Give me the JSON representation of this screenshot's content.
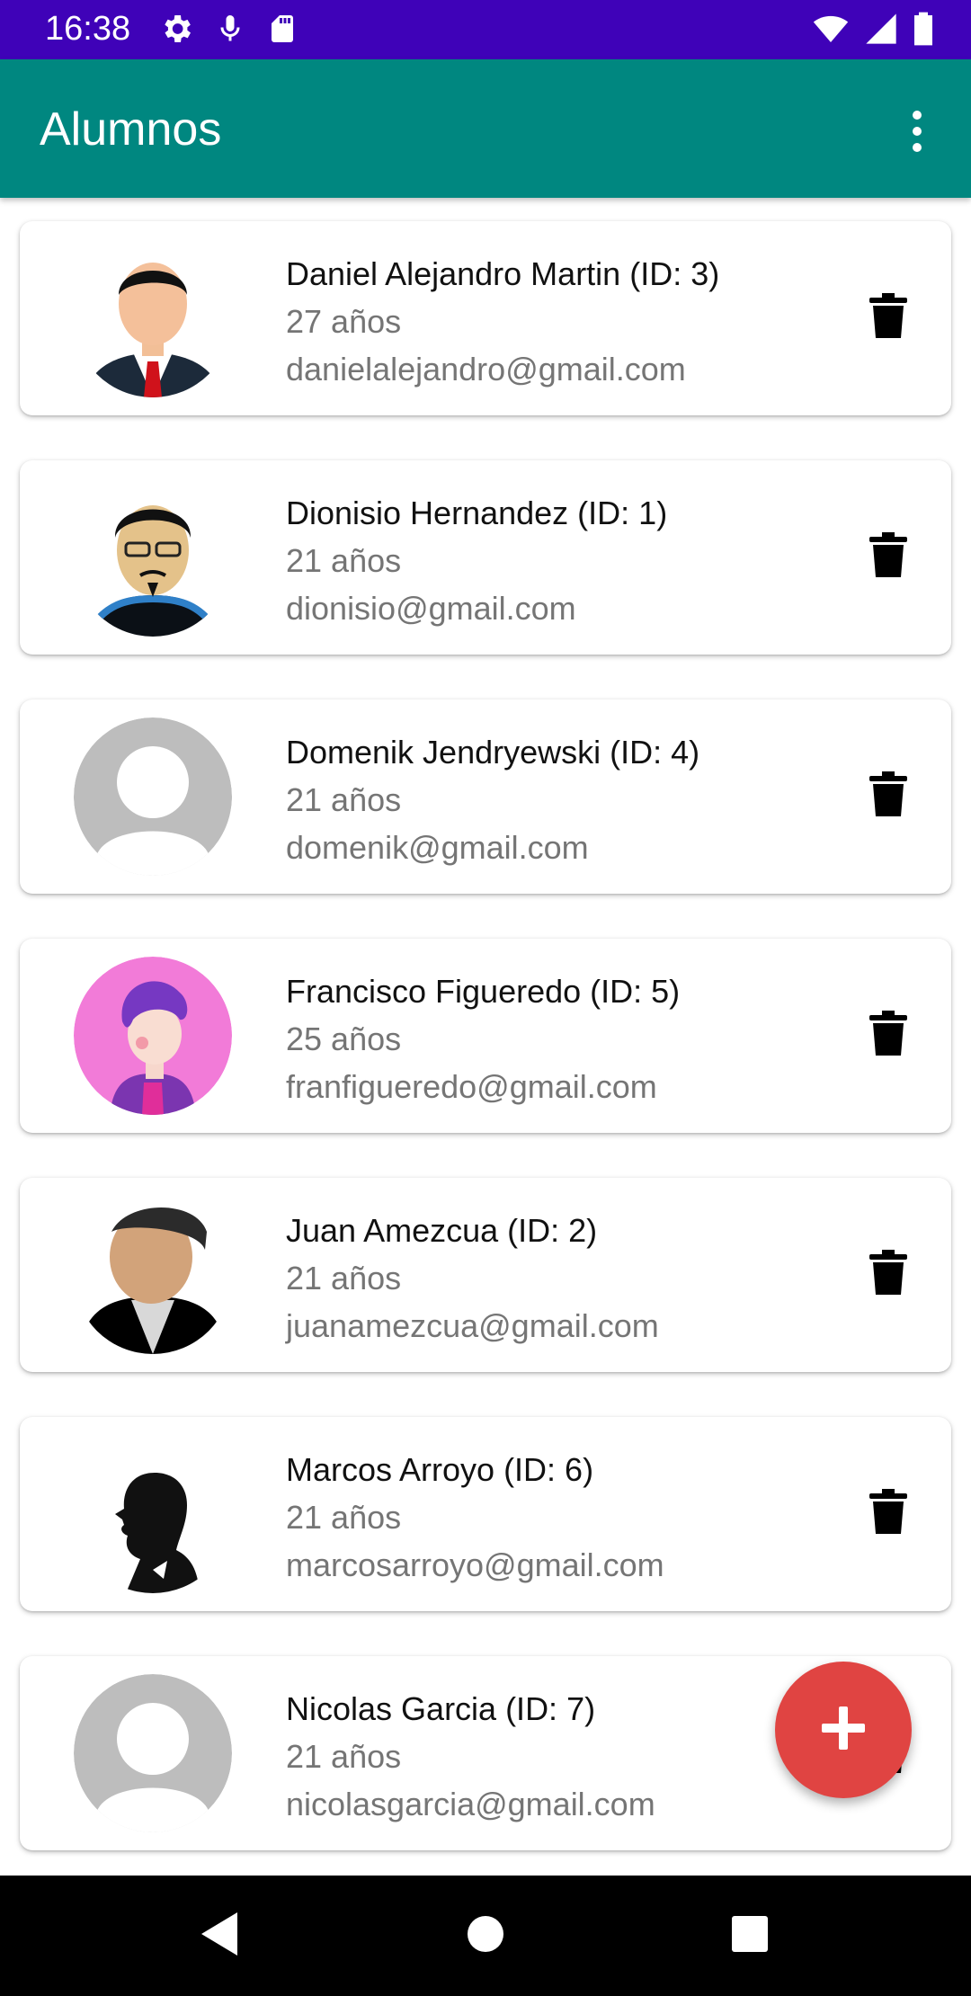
{
  "status_bar": {
    "time": "16:38",
    "icons_left": [
      "gear-icon",
      "mic-icon",
      "sd-card-icon"
    ],
    "icons_right": [
      "wifi-icon",
      "signal-icon",
      "battery-icon"
    ]
  },
  "app_bar": {
    "title": "Alumnos",
    "menu_icon": "more-vert-icon",
    "color": "#008780"
  },
  "students": [
    {
      "name": "Daniel Alejandro Martin (ID: 3)",
      "age": "27 años",
      "email": "danielalejandro@gmail.com",
      "avatar": "man-suit-avatar"
    },
    {
      "name": "Dionisio Hernandez (ID: 1)",
      "age": "21 años",
      "email": "dionisio@gmail.com",
      "avatar": "man-glasses-goatee-avatar"
    },
    {
      "name": "Domenik Jendryewski (ID: 4)",
      "age": "21 años",
      "email": "domenik@gmail.com",
      "avatar": "default-person-avatar"
    },
    {
      "name": "Francisco Figueredo (ID: 5)",
      "age": "25 años",
      "email": "franfigueredo@gmail.com",
      "avatar": "cartoon-curly-hair-avatar"
    },
    {
      "name": "Juan Amezcua (ID: 2)",
      "age": "21 años",
      "email": "juanamezcua@gmail.com",
      "avatar": "man-tuxedo-avatar"
    },
    {
      "name": "Marcos Arroyo (ID: 6)",
      "age": "21 años",
      "email": "marcosarroyo@gmail.com",
      "avatar": "silhouette-profile-avatar"
    },
    {
      "name": "Nicolas Garcia (ID: 7)",
      "age": "21 años",
      "email": "nicolasgarcia@gmail.com",
      "avatar": "default-person-avatar"
    }
  ],
  "fab": {
    "icon": "plus-icon",
    "color": "#e04442"
  },
  "nav_bar": {
    "icons": [
      "back-icon",
      "home-icon",
      "recents-icon"
    ]
  }
}
